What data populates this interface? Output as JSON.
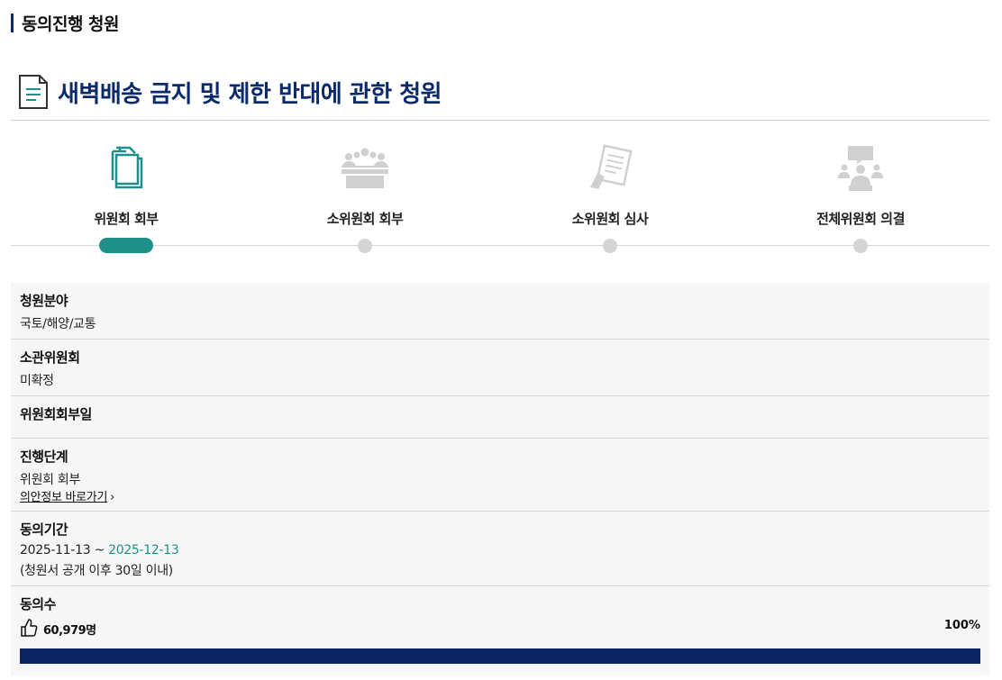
{
  "section_header": "동의진행 청원",
  "petition": {
    "title": "새벽배송 금지 및 제한 반대에 관한 청원"
  },
  "steps": [
    {
      "label": "위원회 회부",
      "icon": "documents-icon",
      "active": true
    },
    {
      "label": "소위원회 회부",
      "icon": "meeting-icon",
      "active": false
    },
    {
      "label": "소위원회 심사",
      "icon": "review-document-icon",
      "active": false
    },
    {
      "label": "전체위원회 의결",
      "icon": "presentation-icon",
      "active": false
    }
  ],
  "info": {
    "field": {
      "label": "청원분야",
      "value": "국토/해양/교통"
    },
    "committee": {
      "label": "소관위원회",
      "value": "미확정"
    },
    "referral_date": {
      "label": "위원회회부일",
      "value": ""
    },
    "stage": {
      "label": "진행단계",
      "value": "위원회 회부",
      "link": "의안정보 바로가기",
      "link_arrow": "›"
    },
    "period": {
      "label": "동의기간",
      "start": "2025-11-13",
      "separator": " ~ ",
      "end": "2025-12-13",
      "note": "(청원서 공개 이후 30일 이내)"
    },
    "consent": {
      "label": "동의수",
      "count": "60,979명",
      "percent_text": "100%",
      "progress": 1.0
    }
  },
  "colors": {
    "accent": "#1f9089",
    "navy": "#0b2a6b",
    "progress": "#0b2462"
  }
}
